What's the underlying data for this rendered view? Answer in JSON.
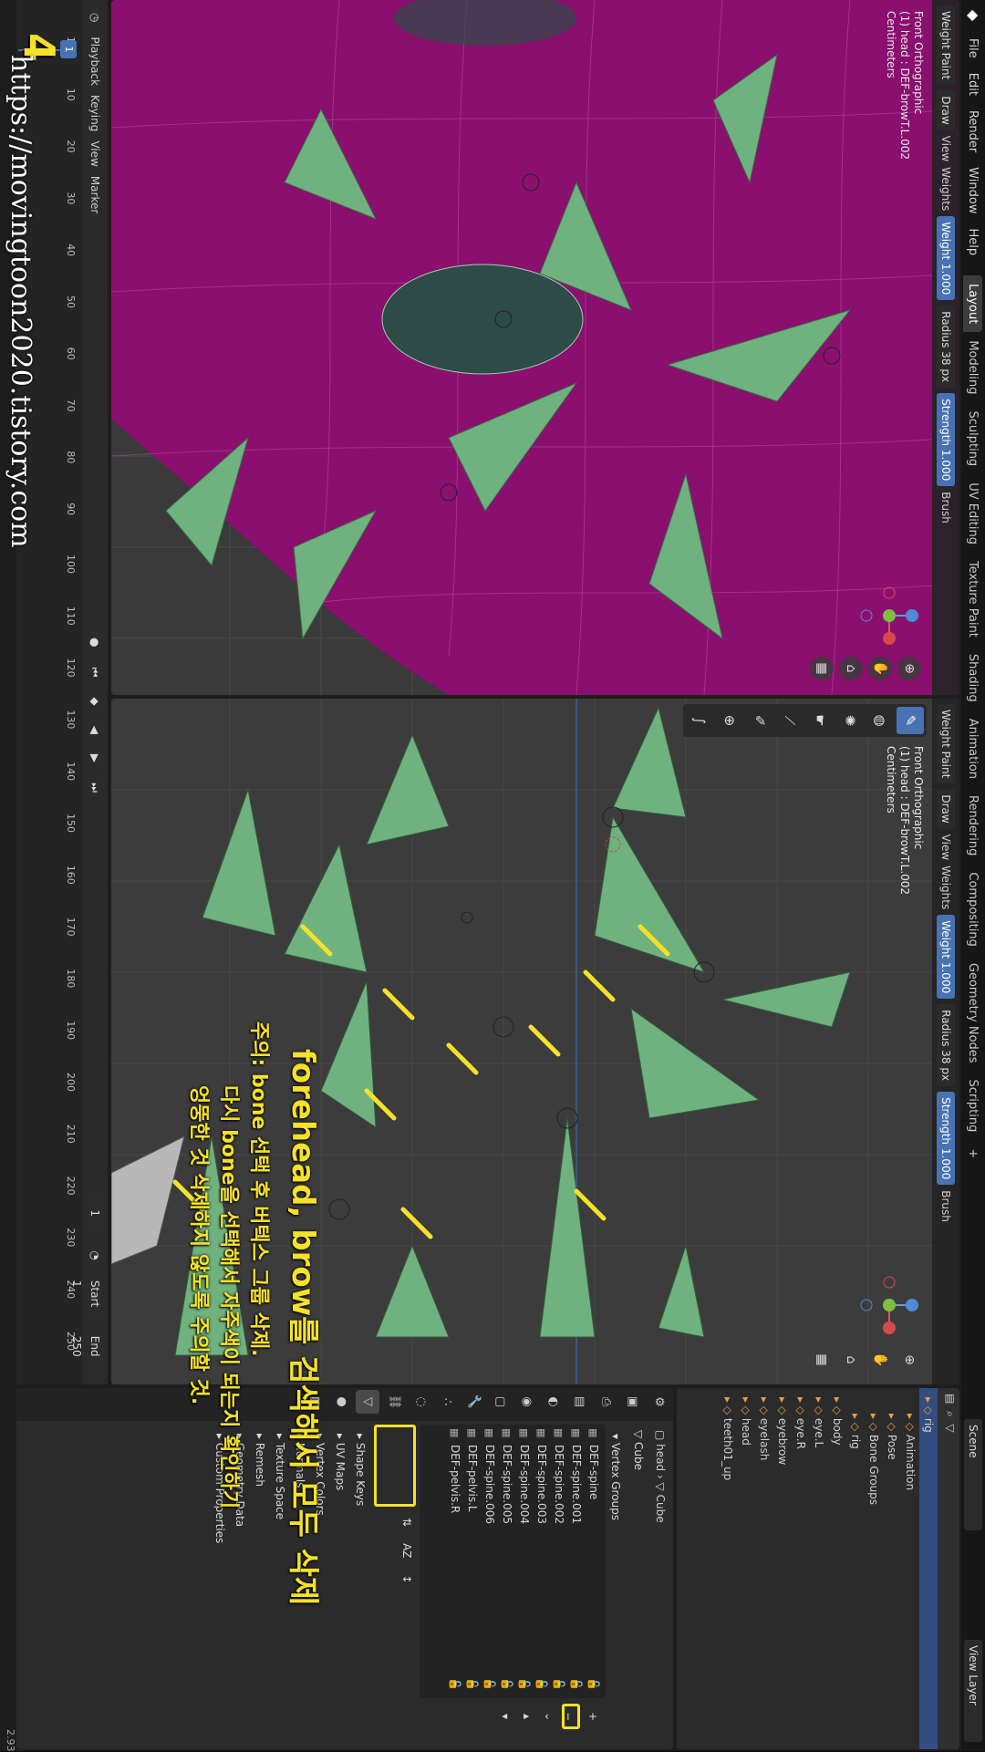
{
  "menu": {
    "items": [
      "File",
      "Edit",
      "Render",
      "Window",
      "Help"
    ],
    "workspaces": [
      "Layout",
      "Modeling",
      "Sculpting",
      "UV Editing",
      "Texture Paint",
      "Shading",
      "Animation",
      "Rendering",
      "Compositing",
      "Geometry Nodes",
      "Scripting"
    ],
    "active_workspace": "Layout",
    "add_tab": "+",
    "scene": "Scene",
    "view_layer": "View Layer"
  },
  "viewport_top": {
    "mode": "Weight Paint",
    "brush": "Draw",
    "menus": [
      "View",
      "Weights"
    ],
    "weight_label": "Weight",
    "weight_value": "1.000",
    "radius_label": "Radius",
    "radius_value": "38 px",
    "strength_label": "Strength",
    "strength_value": "1.000",
    "brush_menu": "Brush",
    "info": [
      "Front Orthographic",
      "(1) head : DEF-browT.L.002",
      "Centimeters"
    ]
  },
  "viewport_bottom": {
    "mode": "Weight Paint",
    "brush": "Draw",
    "menus": [
      "View",
      "Weights"
    ],
    "weight_label": "Weight",
    "weight_value": "1.000",
    "radius_label": "Radius",
    "radius_value": "38 px",
    "strength_label": "Strength",
    "strength_value": "1.000",
    "brush_menu": "Brush",
    "info": [
      "Front Orthographic",
      "(1) head : DEF-browT.L.002",
      "Centimeters"
    ]
  },
  "timeline": {
    "menus": [
      "Playback",
      "Keying",
      "View",
      "Marker"
    ],
    "current_frame": "1",
    "frame_field": "1",
    "start_label": "Start",
    "start_value": "1",
    "end_label": "End",
    "end_value": "250",
    "ticks": [
      "1",
      "10",
      "20",
      "30",
      "40",
      "50",
      "60",
      "70",
      "80",
      "90",
      "100",
      "110",
      "120",
      "130",
      "140",
      "150",
      "160",
      "170",
      "180",
      "190",
      "200",
      "210",
      "220",
      "230",
      "240",
      "250"
    ],
    "version": "2.93"
  },
  "outliner": {
    "items": [
      {
        "label": "rig",
        "indent": 0,
        "highlight": true
      },
      {
        "label": "Animation",
        "indent": 1
      },
      {
        "label": "Pose",
        "indent": 1
      },
      {
        "label": "Bone Groups",
        "indent": 1
      },
      {
        "label": "rig",
        "indent": 1
      },
      {
        "label": "body",
        "indent": 0
      },
      {
        "label": "eye.L",
        "indent": 0
      },
      {
        "label": "eye.R",
        "indent": 0
      },
      {
        "label": "eyebrow",
        "indent": 0
      },
      {
        "label": "eyelash",
        "indent": 0
      },
      {
        "label": "head",
        "indent": 0
      },
      {
        "label": "teeth01_up",
        "indent": 0
      }
    ]
  },
  "properties": {
    "breadcrumb_object": "head",
    "breadcrumb_mesh": "Cube",
    "data_name": "Cube",
    "vertex_groups_header": "Vertex Groups",
    "vertex_groups": [
      "DEF-spine",
      "DEF-spine.001",
      "DEF-spine.002",
      "DEF-spine.003",
      "DEF-spine.004",
      "DEF-spine.005",
      "DEF-spine.006",
      "DEF-pelvis.L",
      "DEF-pelvis.R"
    ],
    "add_button": "+",
    "remove_button": "−",
    "sections": [
      "Shape Keys",
      "UV Maps",
      "Vertex Colors",
      "Normals",
      "Texture Space",
      "Remesh",
      "Geometry Data",
      "Custom Properties"
    ]
  },
  "overlay": {
    "step": "4",
    "url": "https://movingtoon2020.tistory.com",
    "title": "forehead, brow를 검색해서 모두 삭제",
    "note_lines": [
      "주의: bone 선택 후 버텍스 그룹 삭제.",
      "다시 bone을 선택해서 자주색이 되는지 확인하기",
      "엉뚱한 것 삭제하지 않도록 주의할 것."
    ]
  },
  "colors": {
    "accent": "#4772b3",
    "mesh_magenta": "#8a0f6e",
    "bone_green": "#6fb27f",
    "overlay_yellow": "#f5e12a"
  }
}
